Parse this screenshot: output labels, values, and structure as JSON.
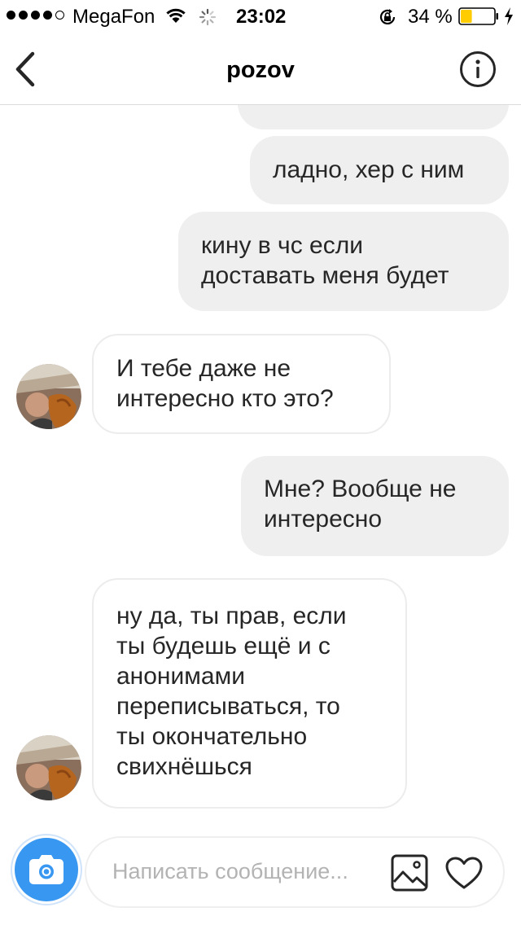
{
  "status_bar": {
    "carrier": "MegaFon",
    "time": "23:02",
    "battery_percent": "34 %",
    "battery_level": 0.34,
    "signal_bars_filled": 4,
    "icons": [
      "wifi-icon",
      "activity-spinner-icon",
      "orientation-lock-icon",
      "battery-icon",
      "charging-bolt-icon"
    ]
  },
  "nav": {
    "title": "pozov",
    "back_icon": "chevron-left-icon",
    "info_icon": "info-icon"
  },
  "messages": [
    {
      "direction": "outgoing",
      "text": "ладно, хер с ним"
    },
    {
      "direction": "outgoing",
      "text": "кину в чс если\nдоставать меня будет"
    },
    {
      "direction": "incoming",
      "text": "И тебе даже не\nинтересно кто это?"
    },
    {
      "direction": "outgoing",
      "text": "Мне? Вообще не\nинтересно"
    },
    {
      "direction": "incoming",
      "text": "ну да, ты прав, если\nты будешь ещё и с\nанонимами\nпереписываться, то\nты окончательно\nсвихнёшься"
    }
  ],
  "composer": {
    "placeholder": "Написать сообщение...",
    "camera_icon": "camera-icon",
    "gallery_icon": "gallery-icon",
    "like_icon": "heart-icon"
  },
  "colors": {
    "accent": "#3897f0",
    "outgoing_bubble": "#efefef",
    "incoming_border": "#ececec",
    "battery_fill": "#ffcc00"
  }
}
